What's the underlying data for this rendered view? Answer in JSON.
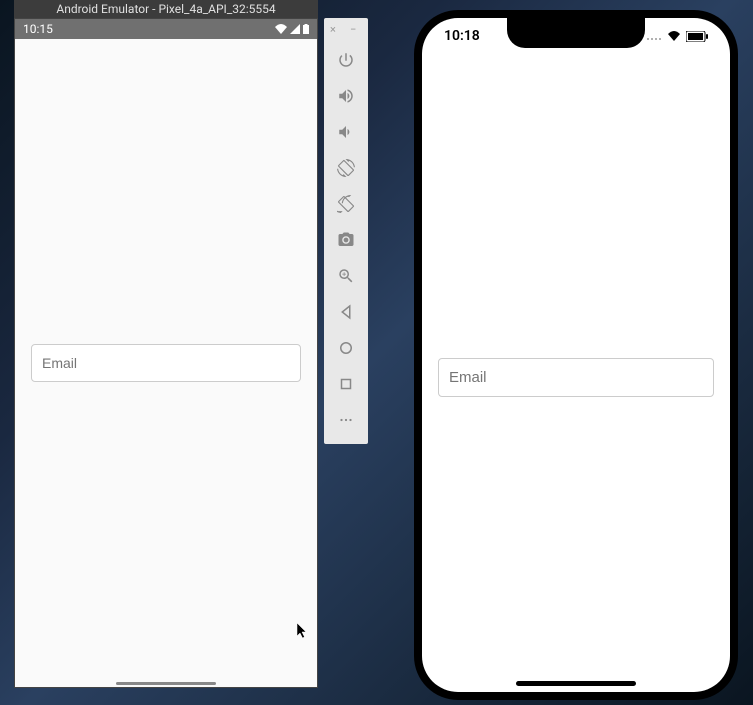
{
  "android": {
    "title": "Android Emulator - Pixel_4a_API_32:5554",
    "statusTime": "10:15",
    "inputPlaceholder": "Email"
  },
  "iphone": {
    "statusTime": "10:18",
    "inputPlaceholder": "Email"
  },
  "sidebar": {
    "closeLabel": "×",
    "minimizeLabel": "−"
  }
}
